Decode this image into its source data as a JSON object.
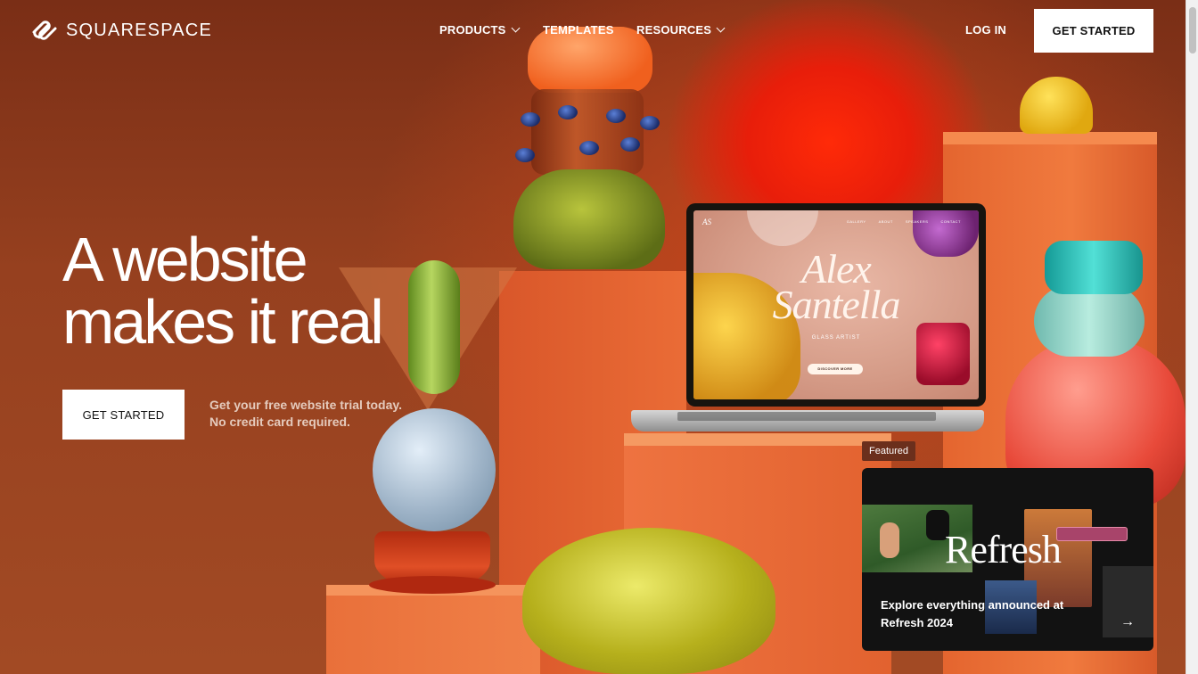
{
  "brand": {
    "name": "SQUARESPACE",
    "icon": "squarespace-logo-icon"
  },
  "nav": {
    "items": [
      {
        "label": "PRODUCTS",
        "has_dropdown": true
      },
      {
        "label": "TEMPLATES",
        "has_dropdown": false
      },
      {
        "label": "RESOURCES",
        "has_dropdown": true
      }
    ],
    "login_label": "LOG IN",
    "cta_label": "GET STARTED"
  },
  "hero": {
    "headline_line1": "A website",
    "headline_line2": "makes it real",
    "cta_label": "GET STARTED",
    "trial_line1": "Get your free website trial today.",
    "trial_line2": "No credit card required."
  },
  "laptop_site": {
    "logo": "AS",
    "nav": [
      "GALLERY",
      "ABOUT",
      "SPEAKERS",
      "CONTACT"
    ],
    "name_line1": "Alex",
    "name_line2": "Santella",
    "subtitle": "GLASS ARTIST",
    "button": "DISCOVER MORE"
  },
  "featured": {
    "tag": "Featured",
    "title": "Refresh",
    "text": "Explore everything announced at Refresh 2024",
    "arrow_icon": "arrow-right-icon"
  },
  "colors": {
    "background": "#8e3a1c",
    "accent_red": "#e81e0a",
    "card_bg": "#121212",
    "white": "#ffffff"
  }
}
